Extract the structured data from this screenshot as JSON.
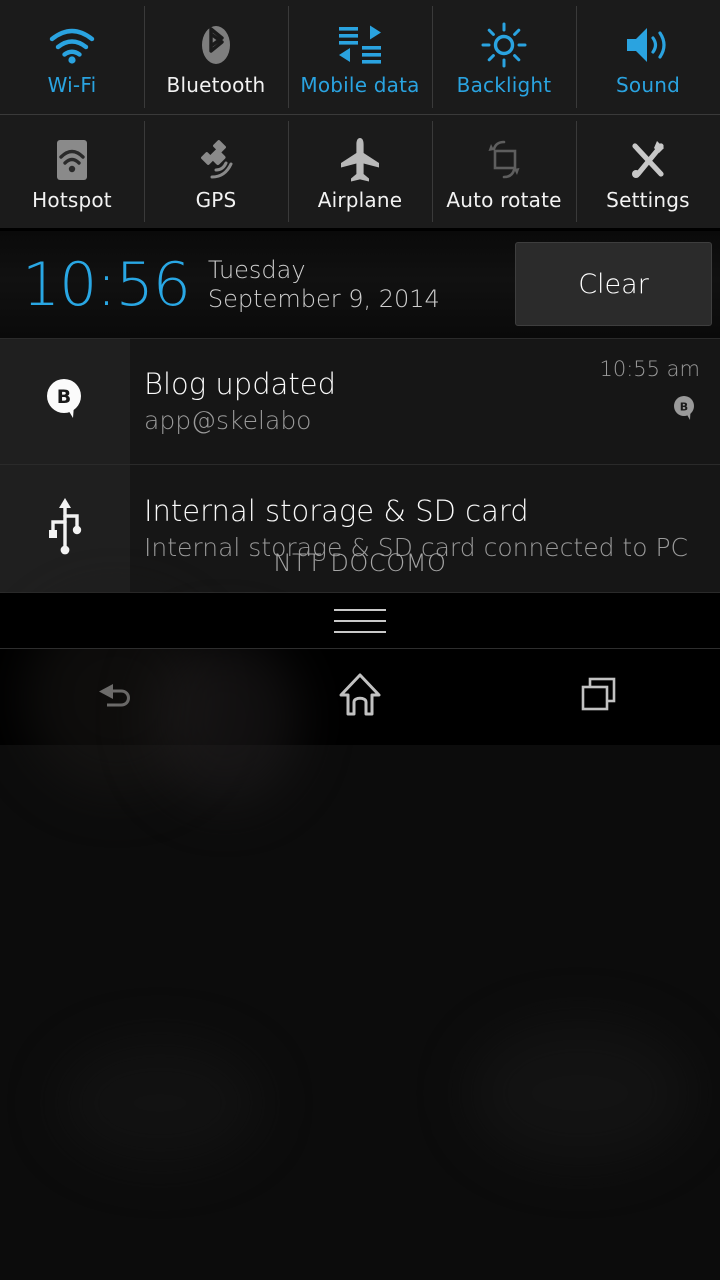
{
  "quick_settings": {
    "rows": [
      [
        {
          "label": "Wi-Fi",
          "icon": "wifi-icon",
          "state": "on"
        },
        {
          "label": "Bluetooth",
          "icon": "bluetooth-icon",
          "state": "off"
        },
        {
          "label": "Mobile data",
          "icon": "mobile-data-icon",
          "state": "on"
        },
        {
          "label": "Backlight",
          "icon": "brightness-icon",
          "state": "on"
        },
        {
          "label": "Sound",
          "icon": "speaker-icon",
          "state": "on"
        }
      ],
      [
        {
          "label": "Hotspot",
          "icon": "hotspot-icon",
          "state": "off"
        },
        {
          "label": "GPS",
          "icon": "gps-satellite-icon",
          "state": "off"
        },
        {
          "label": "Airplane",
          "icon": "airplane-icon",
          "state": "off"
        },
        {
          "label": "Auto rotate",
          "icon": "auto-rotate-icon",
          "state": "off"
        },
        {
          "label": "Settings",
          "icon": "settings-tools-icon",
          "state": "off"
        }
      ]
    ]
  },
  "status": {
    "time": "10:56",
    "day": "Tuesday",
    "date": "September 9, 2014",
    "clear_label": "Clear"
  },
  "notifications": [
    {
      "title": "Blog updated",
      "subtitle": "app@skelabo",
      "time": "10:55 am",
      "icon": "blog-bubble-icon",
      "badge": "blog-bubble-badge-icon",
      "badge_letter": "B"
    },
    {
      "title": "Internal storage & SD card",
      "subtitle": "Internal storage & SD card connected to PC",
      "time": "",
      "icon": "usb-icon",
      "badge": "",
      "badge_letter": ""
    }
  ],
  "carrier": {
    "name": "NTT DOCOMO"
  },
  "navbar": {
    "back": "back-icon",
    "home": "home-icon",
    "recents": "recent-apps-icon"
  },
  "colors": {
    "accent_blue": "#2aa3e0",
    "clock_blue": "#29a7e4",
    "label_inactive": "#f2f2f2",
    "icon_inactive": "#bdbdbd",
    "icon_dim": "#6a6a6a",
    "panel_bg": "#1b1b1b",
    "notif_bg": "#161616",
    "notif_icon_bg": "#1f1f1f",
    "subtitle_gray": "#9a9a9a"
  }
}
